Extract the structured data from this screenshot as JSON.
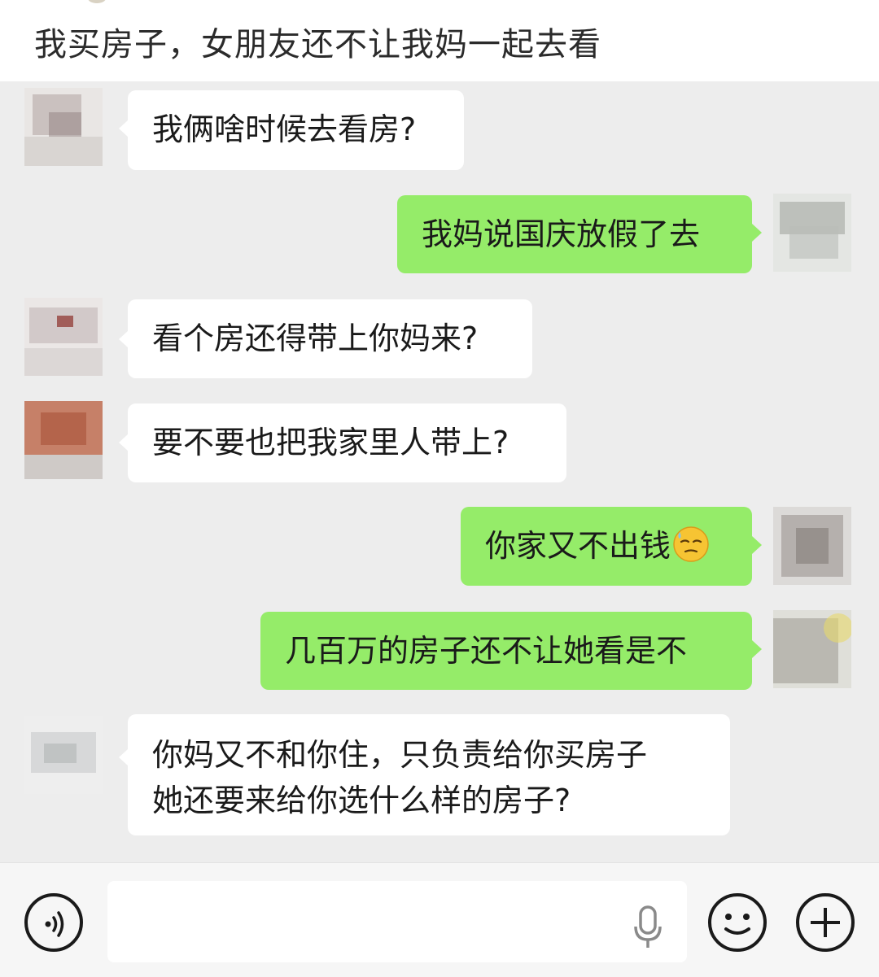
{
  "post": {
    "title": "我买房子，女朋友还不让我妈一起去看"
  },
  "chat": {
    "messages": [
      {
        "side": "in",
        "text": "我俩啥时候去看房?"
      },
      {
        "side": "out",
        "text": "我妈说国庆放假了去"
      },
      {
        "side": "in",
        "text": "看个房还得带上你妈来?"
      },
      {
        "side": "in",
        "text": "要不要也把我家里人带上?"
      },
      {
        "side": "out",
        "text": "你家又不出钱"
      },
      {
        "side": "out",
        "text": "几百万的房子还不让她看是不"
      },
      {
        "side": "in",
        "text_line1": "你妈又不和你住，只负责给你买房子",
        "text_line2": "她还要来给你选什么样的房子?"
      }
    ],
    "emoji": "sweat-smile-emoji"
  },
  "input_bar": {
    "voice_icon": "voice-icon",
    "mic_icon": "microphone-icon",
    "emoji_icon": "emoji-icon",
    "plus_icon": "plus-icon",
    "text_value": ""
  },
  "colors": {
    "chat_bg": "#ededed",
    "incoming_bubble": "#ffffff",
    "outgoing_bubble": "#95ec69",
    "text": "#1a1a1a"
  }
}
